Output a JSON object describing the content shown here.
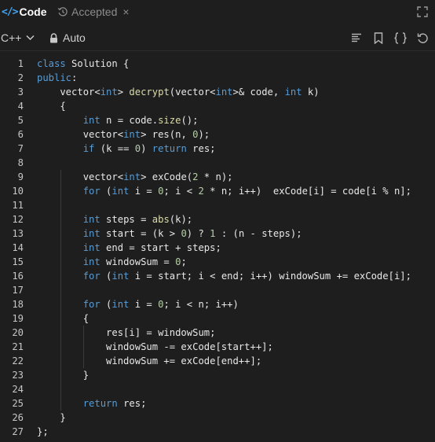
{
  "tabs": {
    "code_icon": "</>",
    "code_label": "Code",
    "accepted_label": "Accepted",
    "close_glyph": "×"
  },
  "toolbar": {
    "language": "C++",
    "mode": "Auto",
    "icons": [
      "format-icon",
      "bookmark-icon",
      "braces-icon",
      "reset-icon"
    ]
  },
  "editor": {
    "lines": [
      {
        "n": "1",
        "t": [
          [
            "kw",
            "class"
          ],
          [
            "pl",
            " Solution {"
          ]
        ]
      },
      {
        "n": "2",
        "t": [
          [
            "kw",
            "public"
          ],
          [
            "pl",
            ":"
          ]
        ]
      },
      {
        "n": "3",
        "t": [
          [
            "pl",
            "    vector<"
          ],
          [
            "ty",
            "int"
          ],
          [
            "pl",
            "> "
          ],
          [
            "fn",
            "decrypt"
          ],
          [
            "pl",
            "(vector<"
          ],
          [
            "ty",
            "int"
          ],
          [
            "pl",
            ">& code, "
          ],
          [
            "ty",
            "int"
          ],
          [
            "pl",
            " k)"
          ]
        ]
      },
      {
        "n": "4",
        "t": [
          [
            "pl",
            "    {"
          ]
        ]
      },
      {
        "n": "5",
        "t": [
          [
            "pl",
            "        "
          ],
          [
            "ty",
            "int"
          ],
          [
            "pl",
            " n = code."
          ],
          [
            "fn",
            "size"
          ],
          [
            "pl",
            "();"
          ]
        ]
      },
      {
        "n": "6",
        "t": [
          [
            "pl",
            "        vector<"
          ],
          [
            "ty",
            "int"
          ],
          [
            "pl",
            "> res(n, "
          ],
          [
            "num",
            "0"
          ],
          [
            "pl",
            ");"
          ]
        ]
      },
      {
        "n": "7",
        "t": [
          [
            "pl",
            "        "
          ],
          [
            "kw",
            "if"
          ],
          [
            "pl",
            " (k == "
          ],
          [
            "num",
            "0"
          ],
          [
            "pl",
            ") "
          ],
          [
            "kw",
            "return"
          ],
          [
            "pl",
            " res;"
          ]
        ]
      },
      {
        "n": "8",
        "t": [
          [
            "pl",
            ""
          ]
        ]
      },
      {
        "n": "9",
        "t": [
          [
            "pl",
            "        vector<"
          ],
          [
            "ty",
            "int"
          ],
          [
            "pl",
            "> exCode("
          ],
          [
            "num",
            "2"
          ],
          [
            "pl",
            " * n);"
          ]
        ]
      },
      {
        "n": "10",
        "t": [
          [
            "pl",
            "        "
          ],
          [
            "kw",
            "for"
          ],
          [
            "pl",
            " ("
          ],
          [
            "ty",
            "int"
          ],
          [
            "pl",
            " i = "
          ],
          [
            "num",
            "0"
          ],
          [
            "pl",
            "; i < "
          ],
          [
            "num",
            "2"
          ],
          [
            "pl",
            " * n; i++)  exCode[i] = code[i % n];"
          ]
        ]
      },
      {
        "n": "11",
        "t": [
          [
            "pl",
            ""
          ]
        ]
      },
      {
        "n": "12",
        "t": [
          [
            "pl",
            "        "
          ],
          [
            "ty",
            "int"
          ],
          [
            "pl",
            " steps = "
          ],
          [
            "fn",
            "abs"
          ],
          [
            "pl",
            "(k);"
          ]
        ]
      },
      {
        "n": "13",
        "t": [
          [
            "pl",
            "        "
          ],
          [
            "ty",
            "int"
          ],
          [
            "pl",
            " start = (k > "
          ],
          [
            "num",
            "0"
          ],
          [
            "pl",
            ") ? "
          ],
          [
            "num",
            "1"
          ],
          [
            "pl",
            " : (n - steps);"
          ]
        ]
      },
      {
        "n": "14",
        "t": [
          [
            "pl",
            "        "
          ],
          [
            "ty",
            "int"
          ],
          [
            "pl",
            " end = start + steps;"
          ]
        ]
      },
      {
        "n": "15",
        "t": [
          [
            "pl",
            "        "
          ],
          [
            "ty",
            "int"
          ],
          [
            "pl",
            " windowSum = "
          ],
          [
            "num",
            "0"
          ],
          [
            "pl",
            ";"
          ]
        ]
      },
      {
        "n": "16",
        "t": [
          [
            "pl",
            "        "
          ],
          [
            "kw",
            "for"
          ],
          [
            "pl",
            " ("
          ],
          [
            "ty",
            "int"
          ],
          [
            "pl",
            " i = start; i < end; i++) windowSum += exCode[i];"
          ]
        ]
      },
      {
        "n": "17",
        "t": [
          [
            "pl",
            ""
          ]
        ]
      },
      {
        "n": "18",
        "t": [
          [
            "pl",
            "        "
          ],
          [
            "kw",
            "for"
          ],
          [
            "pl",
            " ("
          ],
          [
            "ty",
            "int"
          ],
          [
            "pl",
            " i = "
          ],
          [
            "num",
            "0"
          ],
          [
            "pl",
            "; i < n; i++)"
          ]
        ]
      },
      {
        "n": "19",
        "t": [
          [
            "pl",
            "        {"
          ]
        ]
      },
      {
        "n": "20",
        "t": [
          [
            "pl",
            "            res[i] = windowSum;"
          ]
        ]
      },
      {
        "n": "21",
        "t": [
          [
            "pl",
            "            windowSum -= exCode[start++];"
          ]
        ]
      },
      {
        "n": "22",
        "t": [
          [
            "pl",
            "            windowSum += exCode[end++];"
          ]
        ]
      },
      {
        "n": "23",
        "t": [
          [
            "pl",
            "        }"
          ]
        ]
      },
      {
        "n": "24",
        "t": [
          [
            "pl",
            ""
          ]
        ]
      },
      {
        "n": "25",
        "t": [
          [
            "pl",
            "        "
          ],
          [
            "kw",
            "return"
          ],
          [
            "pl",
            " res;"
          ]
        ]
      },
      {
        "n": "26",
        "t": [
          [
            "pl",
            "    }"
          ]
        ]
      },
      {
        "n": "27",
        "t": [
          [
            "pl",
            "};"
          ]
        ]
      }
    ]
  }
}
